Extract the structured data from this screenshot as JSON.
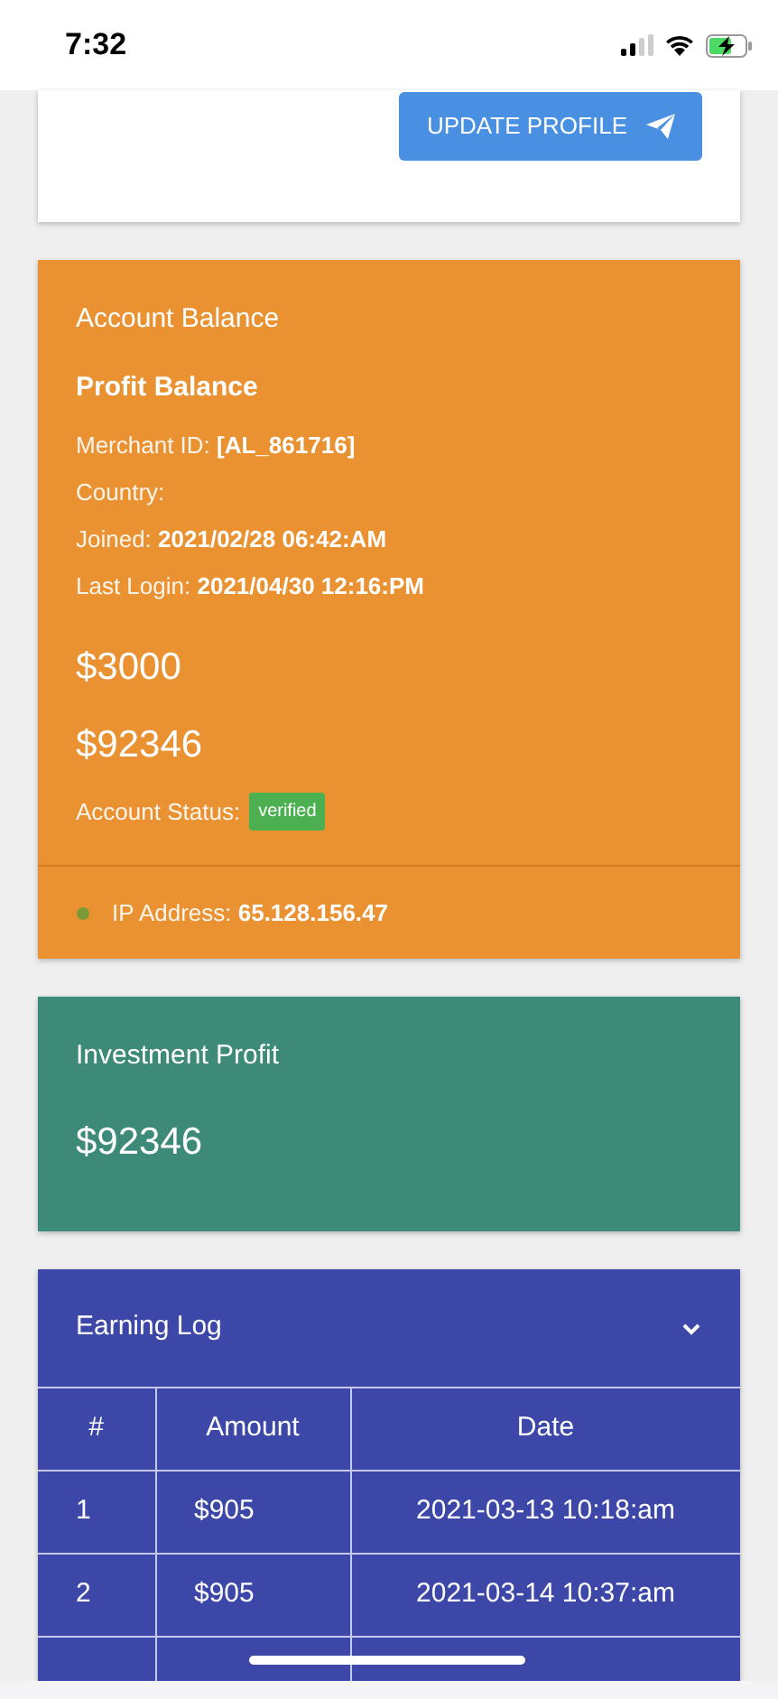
{
  "status_bar": {
    "time": "7:32"
  },
  "profile_card": {
    "button": "UPDATE PROFILE"
  },
  "account_card": {
    "title": "Account Balance",
    "subtitle": "Profit Balance",
    "details": [
      {
        "label": "Merchant ID:",
        "value": "[AL_861716]"
      },
      {
        "label": "Country:"
      },
      {
        "label": "Joined:",
        "value": "2021/02/28 06:42:AM"
      },
      {
        "label": "Last Login:",
        "value": "2021/04/30 12:16:PM"
      }
    ],
    "amounts": [
      "$3000",
      "$92346"
    ],
    "status_label": "Account Status:",
    "status_badge": "verified",
    "ip_label": "IP Address:",
    "ip_value": "65.128.156.47"
  },
  "investment_card": {
    "title": "Investment Profit",
    "amount": "$92346"
  },
  "earning_log": {
    "title": "Earning Log",
    "expanded": true,
    "columns": [
      "#",
      "Amount",
      "Date"
    ],
    "rows": [
      [
        "1",
        "$905",
        "2021-03-13 10:18:am"
      ],
      [
        "2",
        "$905",
        "2021-03-14 10:37:am"
      ]
    ]
  }
}
